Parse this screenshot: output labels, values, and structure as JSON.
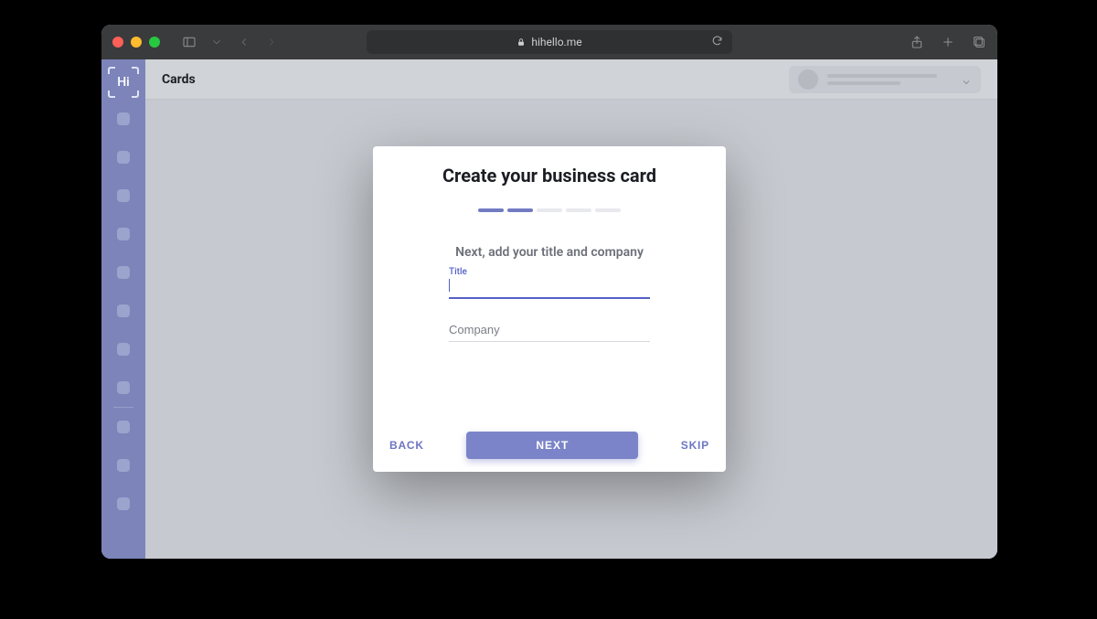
{
  "browser": {
    "url_host": "hihello.me"
  },
  "app": {
    "page_title": "Cards"
  },
  "modal": {
    "title": "Create your business card",
    "subtitle": "Next, add your title and company",
    "progress_total": 5,
    "progress_completed": 2,
    "title_field": {
      "label": "Title",
      "value": ""
    },
    "company_field": {
      "placeholder": "Company",
      "value": ""
    },
    "back_label": "BACK",
    "next_label": "NEXT",
    "skip_label": "SKIP"
  }
}
